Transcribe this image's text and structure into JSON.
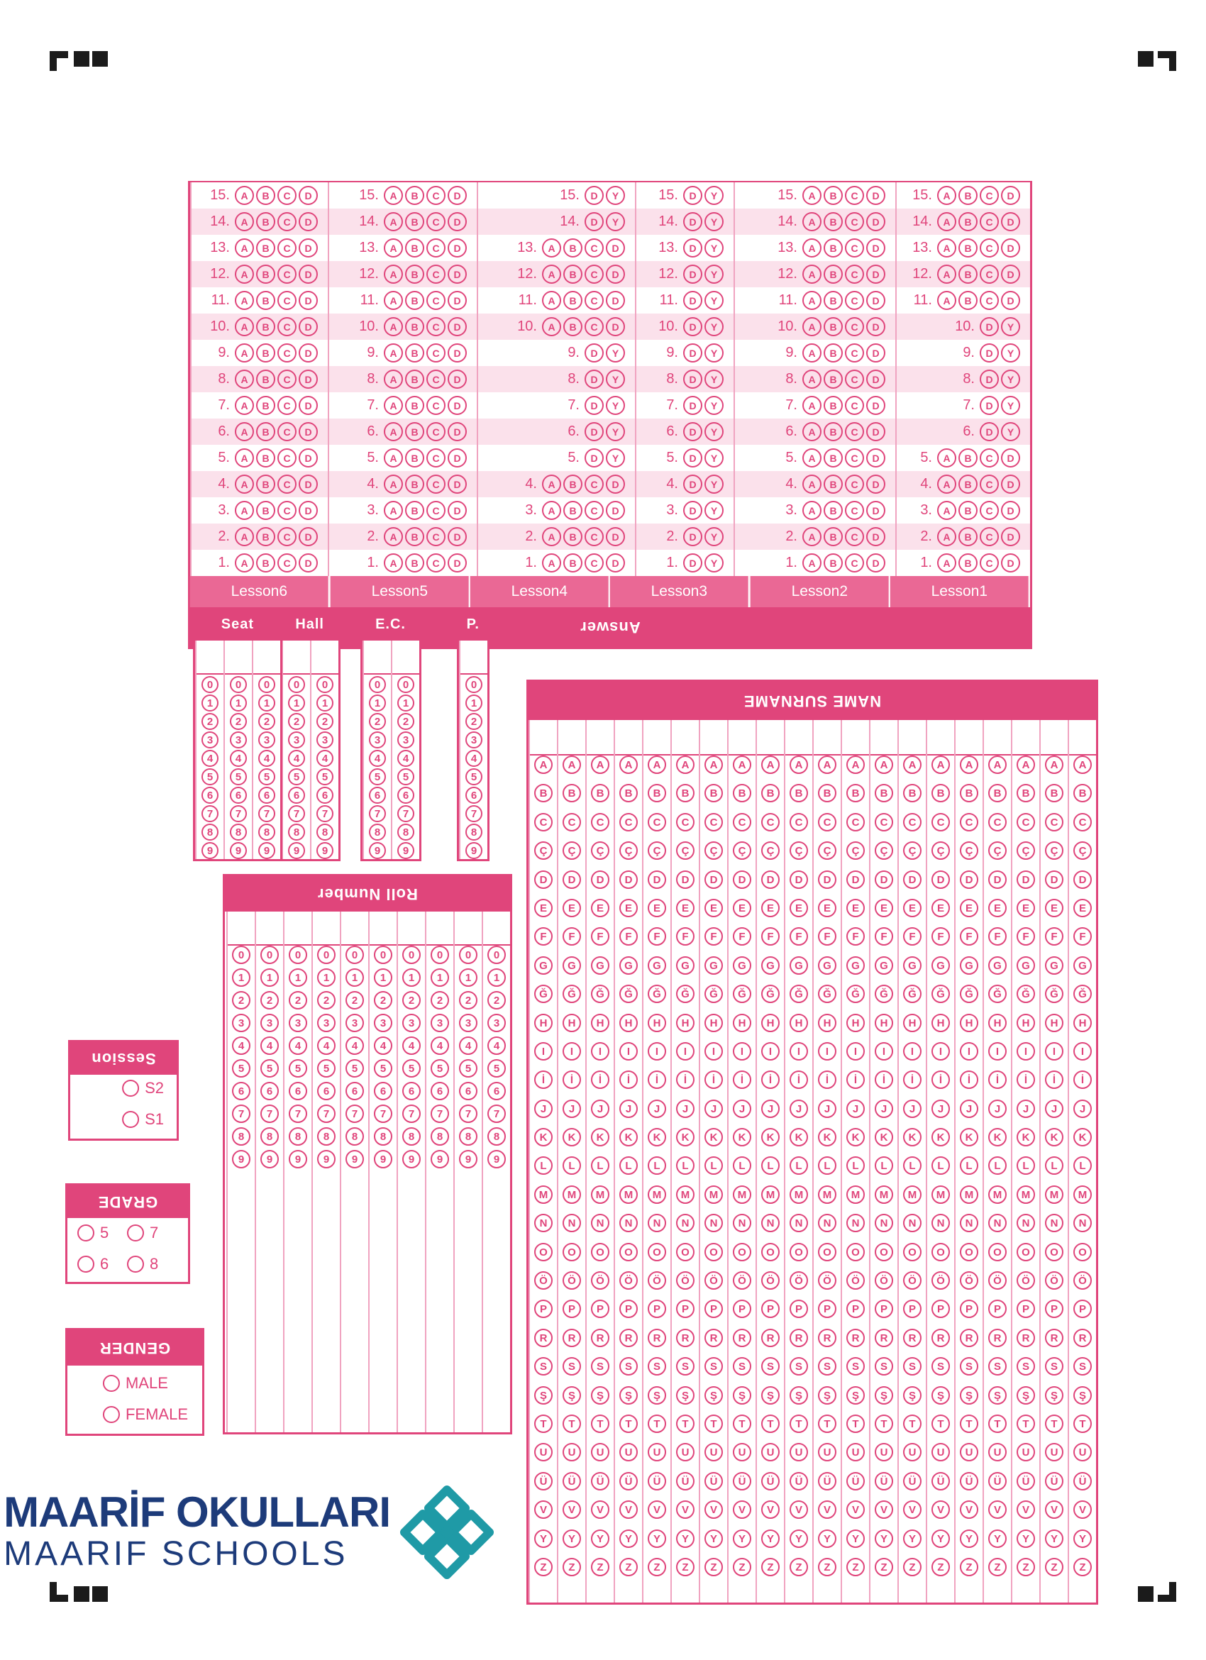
{
  "school": {
    "name_line1": "MAARİF OKULLARI",
    "name_line2": "MAARIF SCHOOLS"
  },
  "name_section": {
    "header": "NAME SURNAME",
    "letters": [
      "A",
      "B",
      "C",
      "Ç",
      "D",
      "E",
      "F",
      "G",
      "Ğ",
      "H",
      "I",
      "İ",
      "J",
      "K",
      "L",
      "M",
      "N",
      "O",
      "Ö",
      "P",
      "R",
      "S",
      "Ş",
      "T",
      "U",
      "Ü",
      "V",
      "Y",
      "Z"
    ]
  },
  "roll_number": {
    "header": "Roll Number",
    "digits": [
      "0",
      "1",
      "2",
      "3",
      "4",
      "5",
      "6",
      "7",
      "8",
      "9"
    ]
  },
  "gender": {
    "header": "GENDER",
    "options": [
      "MALE",
      "FEMALE"
    ]
  },
  "grade": {
    "header": "GRADE",
    "options": [
      "5",
      "7",
      "6",
      "8"
    ]
  },
  "session": {
    "header": "Session",
    "options": [
      "S1",
      "S2"
    ]
  },
  "small_boxes": [
    {
      "label": "P.",
      "columns": 1
    },
    {
      "label": "E.C.",
      "columns": 2
    },
    {
      "label": "Hall",
      "columns": 2
    },
    {
      "label": "Seat",
      "columns": 3
    }
  ],
  "answer": {
    "header": "Answer",
    "lessons": [
      {
        "name": "Lesson1",
        "rows": [
          [
            "A",
            "B",
            "C",
            "D"
          ],
          [
            "A",
            "B",
            "C",
            "D"
          ],
          [
            "A",
            "B",
            "C",
            "D"
          ],
          [
            "A",
            "B",
            "C",
            "D"
          ],
          [
            "A",
            "B",
            "C",
            "D"
          ],
          [
            "D",
            "Y"
          ],
          [
            "D",
            "Y"
          ],
          [
            "D",
            "Y"
          ],
          [
            "D",
            "Y"
          ],
          [
            "D",
            "Y"
          ],
          [
            "A",
            "B",
            "C",
            "D"
          ],
          [
            "A",
            "B",
            "C",
            "D"
          ],
          [
            "A",
            "B",
            "C",
            "D"
          ],
          [
            "A",
            "B",
            "C",
            "D"
          ],
          [
            "A",
            "B",
            "C",
            "D"
          ]
        ]
      },
      {
        "name": "Lesson2",
        "rows": [
          [
            "A",
            "B",
            "C",
            "D"
          ],
          [
            "A",
            "B",
            "C",
            "D"
          ],
          [
            "A",
            "B",
            "C",
            "D"
          ],
          [
            "A",
            "B",
            "C",
            "D"
          ],
          [
            "A",
            "B",
            "C",
            "D"
          ],
          [
            "A",
            "B",
            "C",
            "D"
          ],
          [
            "A",
            "B",
            "C",
            "D"
          ],
          [
            "A",
            "B",
            "C",
            "D"
          ],
          [
            "A",
            "B",
            "C",
            "D"
          ],
          [
            "A",
            "B",
            "C",
            "D"
          ],
          [
            "A",
            "B",
            "C",
            "D"
          ],
          [
            "A",
            "B",
            "C",
            "D"
          ],
          [
            "A",
            "B",
            "C",
            "D"
          ],
          [
            "A",
            "B",
            "C",
            "D"
          ],
          [
            "A",
            "B",
            "C",
            "D"
          ]
        ]
      },
      {
        "name": "Lesson3",
        "rows": [
          [
            "D",
            "Y"
          ],
          [
            "D",
            "Y"
          ],
          [
            "D",
            "Y"
          ],
          [
            "D",
            "Y"
          ],
          [
            "D",
            "Y"
          ],
          [
            "D",
            "Y"
          ],
          [
            "D",
            "Y"
          ],
          [
            "D",
            "Y"
          ],
          [
            "D",
            "Y"
          ],
          [
            "D",
            "Y"
          ],
          [
            "D",
            "Y"
          ],
          [
            "D",
            "Y"
          ],
          [
            "D",
            "Y"
          ],
          [
            "D",
            "Y"
          ],
          [
            "D",
            "Y"
          ]
        ]
      },
      {
        "name": "Lesson4",
        "rows": [
          [
            "A",
            "B",
            "C",
            "D"
          ],
          [
            "A",
            "B",
            "C",
            "D"
          ],
          [
            "A",
            "B",
            "C",
            "D"
          ],
          [
            "A",
            "B",
            "C",
            "D"
          ],
          [
            "D",
            "Y"
          ],
          [
            "D",
            "Y"
          ],
          [
            "D",
            "Y"
          ],
          [
            "D",
            "Y"
          ],
          [
            "D",
            "Y"
          ],
          [
            "A",
            "B",
            "C",
            "D"
          ],
          [
            "A",
            "B",
            "C",
            "D"
          ],
          [
            "A",
            "B",
            "C",
            "D"
          ],
          [
            "A",
            "B",
            "C",
            "D"
          ],
          [
            "D",
            "Y"
          ],
          [
            "D",
            "Y"
          ]
        ]
      },
      {
        "name": "Lesson5",
        "rows": [
          [
            "A",
            "B",
            "C",
            "D"
          ],
          [
            "A",
            "B",
            "C",
            "D"
          ],
          [
            "A",
            "B",
            "C",
            "D"
          ],
          [
            "A",
            "B",
            "C",
            "D"
          ],
          [
            "A",
            "B",
            "C",
            "D"
          ],
          [
            "A",
            "B",
            "C",
            "D"
          ],
          [
            "A",
            "B",
            "C",
            "D"
          ],
          [
            "A",
            "B",
            "C",
            "D"
          ],
          [
            "A",
            "B",
            "C",
            "D"
          ],
          [
            "A",
            "B",
            "C",
            "D"
          ],
          [
            "A",
            "B",
            "C",
            "D"
          ],
          [
            "A",
            "B",
            "C",
            "D"
          ],
          [
            "A",
            "B",
            "C",
            "D"
          ],
          [
            "A",
            "B",
            "C",
            "D"
          ],
          [
            "A",
            "B",
            "C",
            "D"
          ]
        ]
      },
      {
        "name": "Lesson6",
        "rows": [
          [
            "A",
            "B",
            "C",
            "D"
          ],
          [
            "A",
            "B",
            "C",
            "D"
          ],
          [
            "A",
            "B",
            "C",
            "D"
          ],
          [
            "A",
            "B",
            "C",
            "D"
          ],
          [
            "A",
            "B",
            "C",
            "D"
          ],
          [
            "A",
            "B",
            "C",
            "D"
          ],
          [
            "A",
            "B",
            "C",
            "D"
          ],
          [
            "A",
            "B",
            "C",
            "D"
          ],
          [
            "A",
            "B",
            "C",
            "D"
          ],
          [
            "A",
            "B",
            "C",
            "D"
          ],
          [
            "A",
            "B",
            "C",
            "D"
          ],
          [
            "A",
            "B",
            "C",
            "D"
          ],
          [
            "A",
            "B",
            "C",
            "D"
          ],
          [
            "A",
            "B",
            "C",
            "D"
          ],
          [
            "A",
            "B",
            "C",
            "D"
          ]
        ]
      }
    ]
  },
  "colors": {
    "primary": "#e0457b",
    "secondary": "#ea6895",
    "stripe": "#fbe1eb",
    "logo_teal": "#1f9aa6",
    "logo_navy": "#1d3b7a"
  }
}
